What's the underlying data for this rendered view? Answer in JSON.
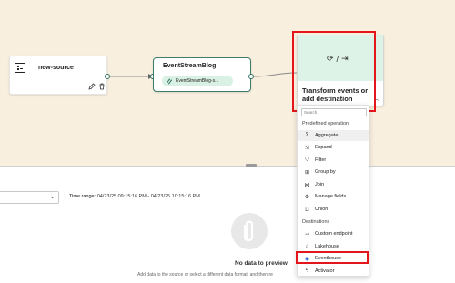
{
  "canvas": {
    "source_node": {
      "label": "new-source"
    },
    "stream_node": {
      "title": "EventStreamBlog",
      "chip_text": "EventStreamBlog-s..."
    },
    "transform_node": {
      "label": "Transform events or add destination",
      "icons": [
        "transform-icon",
        "export-icon"
      ],
      "separator": "/"
    }
  },
  "menu": {
    "search_placeholder": "Search",
    "predefined_header": "Predefined operation",
    "operations": [
      {
        "label": "Aggregate",
        "icon": "Σ"
      },
      {
        "label": "Expand",
        "icon": "⇲"
      },
      {
        "label": "Filter",
        "icon": "⛉"
      },
      {
        "label": "Group by",
        "icon": "⊞"
      },
      {
        "label": "Join",
        "icon": "⋈"
      },
      {
        "label": "Manage fields",
        "icon": "⚙"
      },
      {
        "label": "Union",
        "icon": "⊔"
      }
    ],
    "destinations_header": "Destinations",
    "destinations": [
      {
        "label": "Custom endpoint",
        "icon": "⊸"
      },
      {
        "label": "Lakehouse",
        "icon": "⌂"
      },
      {
        "label": "Eventhouse",
        "icon": "◉"
      },
      {
        "label": "Activator",
        "icon": "ϟ"
      }
    ]
  },
  "preview": {
    "time_range_label": "Time range:",
    "time_range_value": "04/23/25 09:15:16 PM - 04/23/25 10:15:16 PM",
    "empty_title": "No data to preview",
    "empty_desc": "Add data to the source or select a different data format, and then re"
  },
  "colors": {
    "canvas_bg": "#f8efdf",
    "accent_green": "#3e7d6a",
    "highlight_red": "#e4161b",
    "transform_bg": "#def3e8"
  }
}
